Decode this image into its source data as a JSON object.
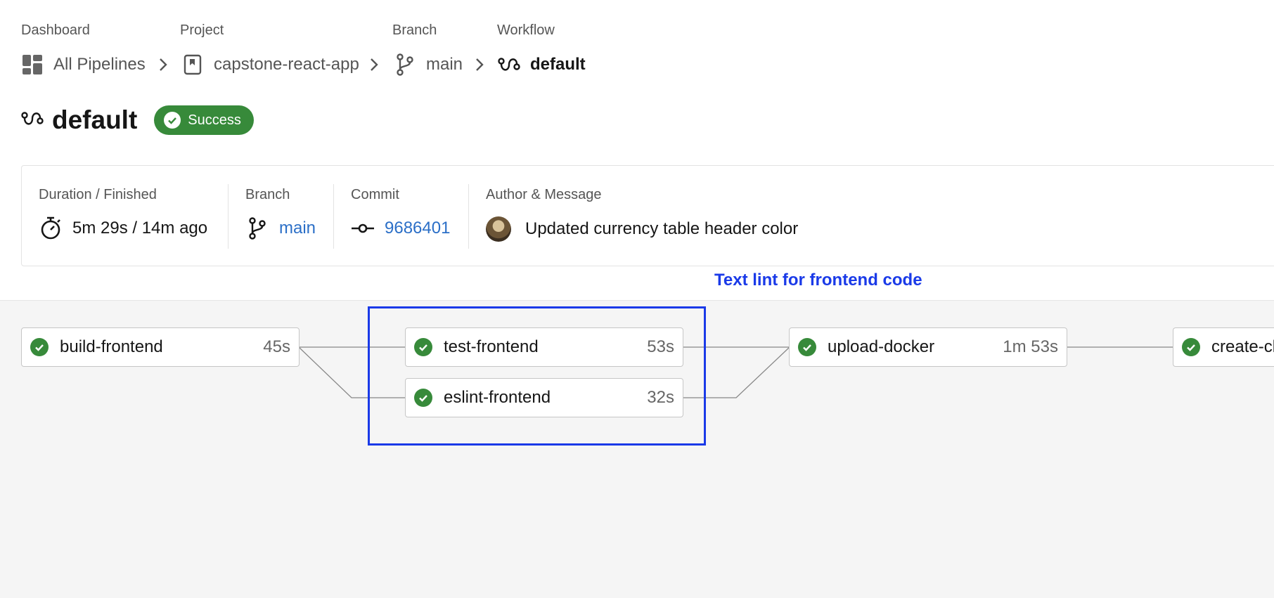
{
  "breadcrumb": {
    "items": [
      {
        "label": "Dashboard",
        "value": "All Pipelines",
        "icon": "dashboard-icon"
      },
      {
        "label": "Project",
        "value": "capstone-react-app",
        "icon": "bookmark-icon"
      },
      {
        "label": "Branch",
        "value": "main",
        "icon": "branch-icon"
      },
      {
        "label": "Workflow",
        "value": "default",
        "icon": "workflow-icon"
      }
    ]
  },
  "header": {
    "title": "default",
    "status": "Success",
    "status_color": "#378a3a"
  },
  "summary": {
    "duration_label": "Duration / Finished",
    "duration_value": "5m 29s / 14m ago",
    "branch_label": "Branch",
    "branch_value": "main",
    "commit_label": "Commit",
    "commit_value": "9686401",
    "author_label": "Author & Message",
    "message": "Updated currency table header color",
    "link_color": "#2b6fc7"
  },
  "annotation": {
    "text": "Text lint for frontend code",
    "color": "#1a3ae8"
  },
  "jobs": [
    {
      "name": "build-frontend",
      "duration": "45s",
      "status": "success"
    },
    {
      "name": "test-frontend",
      "duration": "53s",
      "status": "success"
    },
    {
      "name": "eslint-frontend",
      "duration": "32s",
      "status": "success"
    },
    {
      "name": "upload-docker",
      "duration": "1m 53s",
      "status": "success"
    },
    {
      "name": "create-cl",
      "duration": "",
      "status": "success"
    }
  ]
}
